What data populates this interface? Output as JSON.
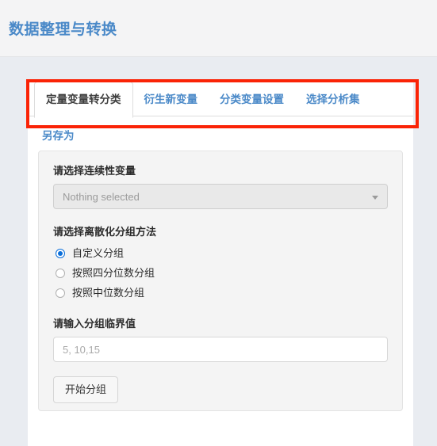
{
  "header": {
    "title": "数据整理与转换"
  },
  "tabs": [
    {
      "label": "定量变量转分类",
      "active": true
    },
    {
      "label": "衍生新变量",
      "active": false
    },
    {
      "label": "分类变量设置",
      "active": false
    },
    {
      "label": "选择分析集",
      "active": false
    }
  ],
  "toolbar": {
    "save_as_label": "另存为"
  },
  "form": {
    "continuous_variable": {
      "label": "请选择连续性变量",
      "selected_text": "Nothing selected",
      "disabled": true,
      "caret_icon": "chevron-down-icon"
    },
    "discretize_method": {
      "label": "请选择离散化分组方法",
      "options": [
        {
          "label": "自定义分组",
          "checked": true
        },
        {
          "label": "按照四分位数分组",
          "checked": false
        },
        {
          "label": "按照中位数分组",
          "checked": false
        }
      ]
    },
    "cutoff_values": {
      "label": "请输入分组临界值",
      "value": "",
      "placeholder": "5, 10,15"
    },
    "submit_button": {
      "label": "开始分组"
    }
  },
  "annotation": {
    "shape": "rectangle",
    "color": "#fa2306",
    "target": "tab-bar"
  },
  "colors": {
    "title_blue": "#4a89c8",
    "link_blue": "#4a89c8",
    "radio_blue": "#0a6ed9",
    "page_background": "#e9ecf1",
    "header_background": "#f4f4f5",
    "panel_background": "#f4f4f4",
    "annotation_red": "#fa2306"
  }
}
